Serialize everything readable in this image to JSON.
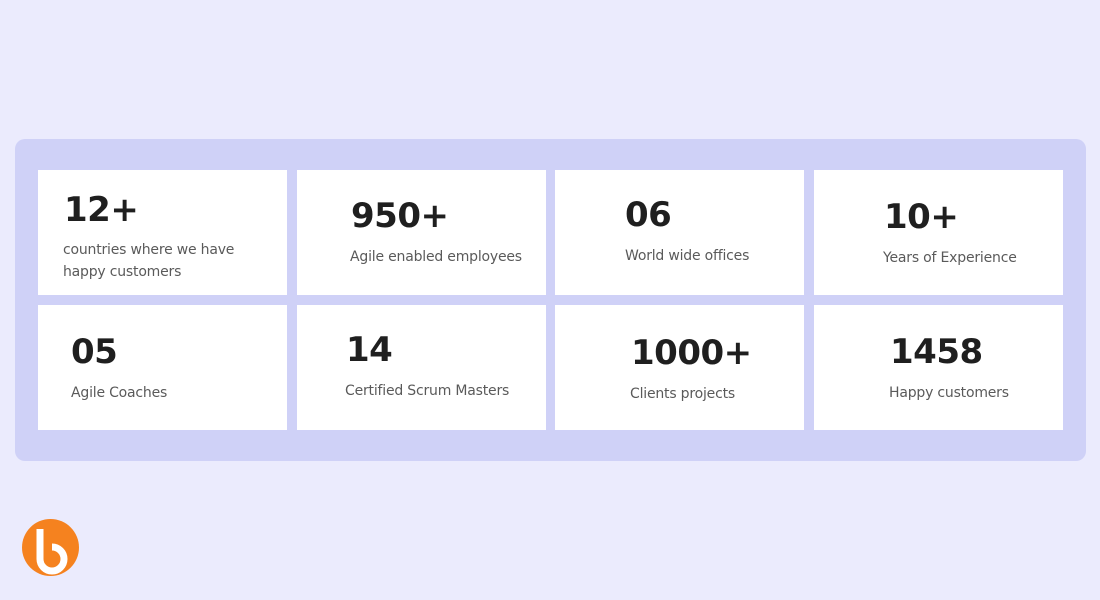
{
  "stats": [
    {
      "value": "12+",
      "label": "countries where we have happy customers"
    },
    {
      "value": "950+",
      "label": "Agile enabled employees"
    },
    {
      "value": "06",
      "label": "World wide offices"
    },
    {
      "value": "10+",
      "label": "Years of Experience"
    },
    {
      "value": "05",
      "label": "Agile Coaches"
    },
    {
      "value": "14",
      "label": "Certified Scrum Masters"
    },
    {
      "value": "1000+",
      "label": "Clients projects"
    },
    {
      "value": "1458",
      "label": "Happy customers"
    }
  ],
  "colors": {
    "page_background": "#ebebfd",
    "panel_background": "#cfd1f7",
    "card_background": "#ffffff",
    "value_text": "#1f1f1f",
    "label_text": "#5a5a5a",
    "logo_orange": "#f5821f"
  },
  "logo": {
    "icon": "brand-logo-icon"
  }
}
